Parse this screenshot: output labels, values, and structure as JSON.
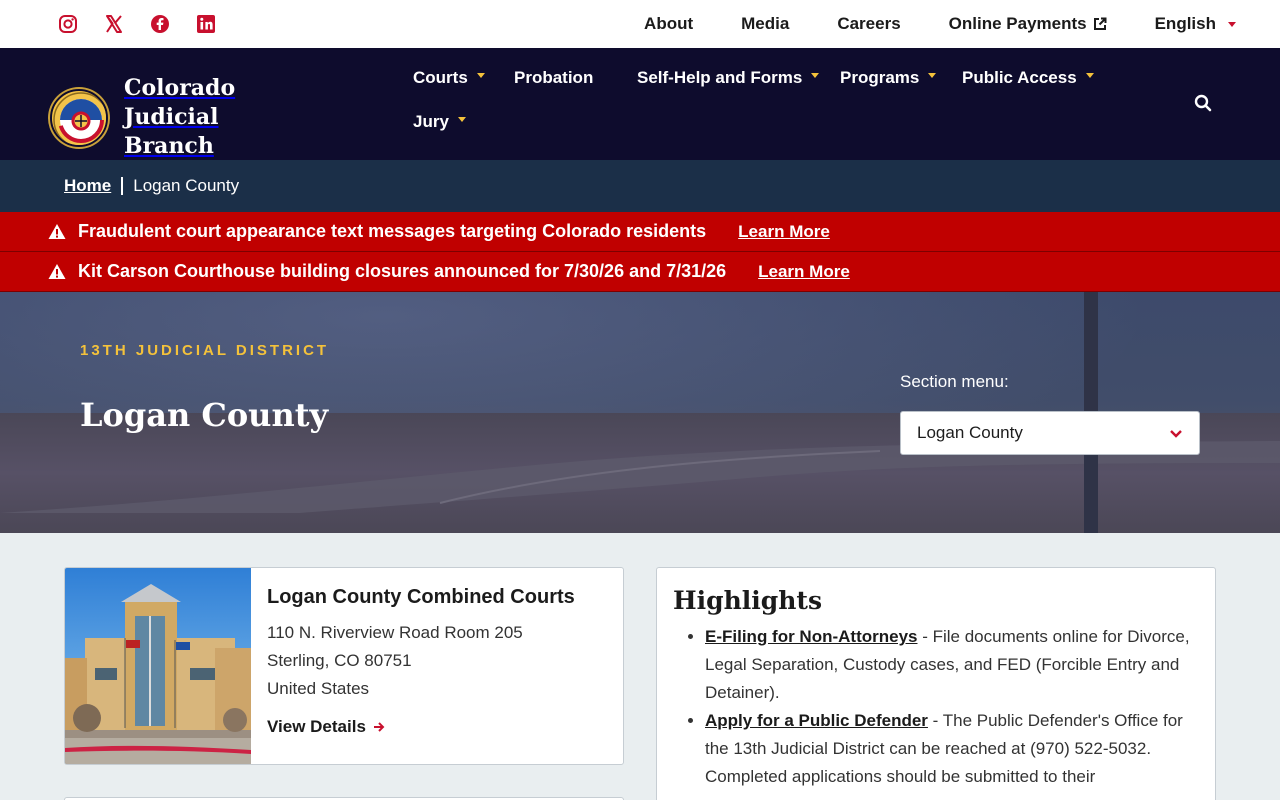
{
  "utility_nav": {
    "social": [
      "instagram-icon",
      "x-icon",
      "facebook-icon",
      "linkedin-icon"
    ],
    "links": [
      "About",
      "Media",
      "Careers",
      "Online Payments",
      "English"
    ]
  },
  "header": {
    "brand_line1": "Colorado Judicial",
    "brand_line2": "Branch",
    "nav": [
      "Courts",
      "Probation",
      "Self-Help and Forms",
      "Programs",
      "Public Access",
      "Jury"
    ]
  },
  "breadcrumb": {
    "home": "Home",
    "current": "Logan County"
  },
  "alerts": [
    {
      "message": "Fraudulent court appearance text messages targeting Colorado residents",
      "link": "Learn More"
    },
    {
      "message": "Kit Carson Courthouse building closures announced for 7/30/26 and 7/31/26",
      "link": "Learn More"
    }
  ],
  "hero": {
    "eyebrow": "13TH JUDICIAL DISTRICT",
    "title": "Logan County",
    "section_menu_label": "Section menu:",
    "section_menu_value": "Logan County"
  },
  "court_card": {
    "name": "Logan County Combined Courts",
    "address_line1": "110 N. Riverview Road Room 205",
    "address_line2": "Sterling, CO 80751",
    "address_line3": "United States",
    "link": "View Details"
  },
  "highlights": {
    "title": "Highlights",
    "items": [
      {
        "link": "E-Filing for Non-Attorneys",
        "text": " - File documents online for Divorce, Legal Separation, Custody cases, and FED (Forcible Entry and Detainer)."
      },
      {
        "link": "Apply for a Public Defender",
        "text": " - The Public Defender's Office for the 13th Judicial District can be reached at (970) 522-5032. Completed applications should be submitted to their"
      }
    ]
  },
  "colors": {
    "navy": "#0e0c2d",
    "breadcrumb_bg": "#1b2f48",
    "alert_red": "#c00000",
    "gold": "#f4c23b",
    "accent_red": "#c8102e"
  }
}
